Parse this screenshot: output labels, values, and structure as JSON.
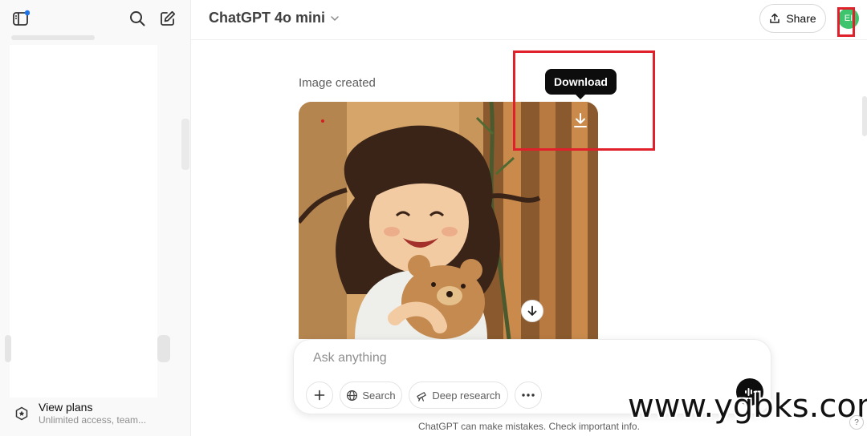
{
  "sidebar": {
    "plans_title": "View plans",
    "plans_subtitle": "Unlimited access, team..."
  },
  "header": {
    "model_name": "ChatGPT 4o mini",
    "share_label": "Share",
    "avatar_initials": "EI"
  },
  "message": {
    "image_caption": "Image created",
    "download_tooltip": "Download"
  },
  "composer": {
    "placeholder": "Ask anything",
    "search_label": "Search",
    "deep_research_label": "Deep research"
  },
  "footer": {
    "disclaimer": "ChatGPT can make mistakes. Check important info.",
    "help": "?"
  },
  "watermark": "www.ygbks.com",
  "colors": {
    "accent_green": "#3ec46d",
    "highlight_red": "#e0202a",
    "tooltip_bg": "#0d0d0d"
  }
}
